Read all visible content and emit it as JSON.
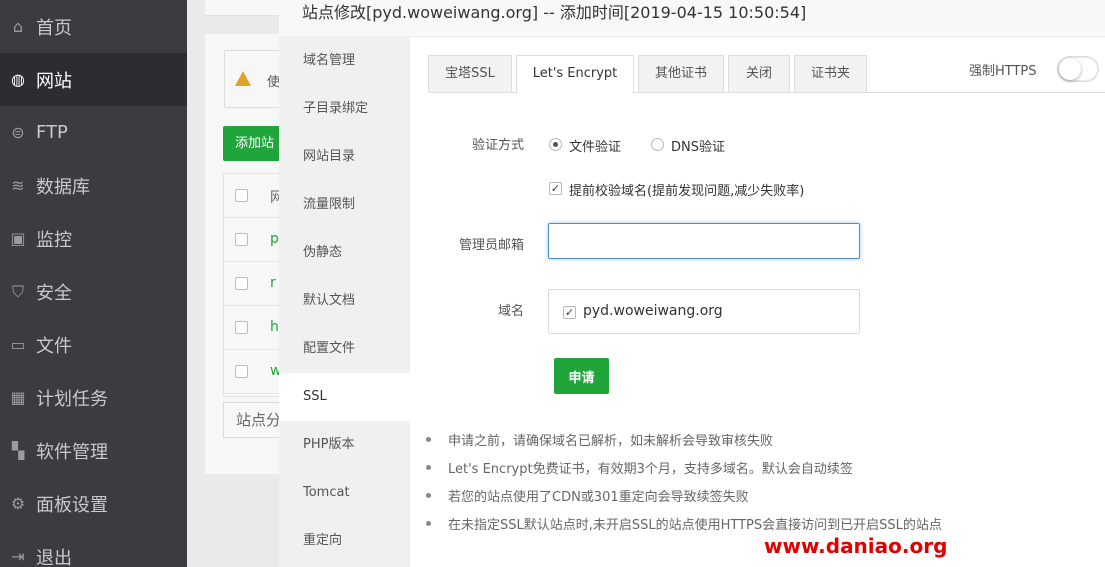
{
  "sidebar": {
    "items": [
      {
        "label": "首页",
        "icon": "home-icon"
      },
      {
        "label": "网站",
        "icon": "globe-icon"
      },
      {
        "label": "FTP",
        "icon": "ftp-icon"
      },
      {
        "label": "数据库",
        "icon": "database-icon"
      },
      {
        "label": "监控",
        "icon": "monitor-icon"
      },
      {
        "label": "安全",
        "icon": "shield-icon"
      },
      {
        "label": "文件",
        "icon": "folder-icon"
      },
      {
        "label": "计划任务",
        "icon": "calendar-icon"
      },
      {
        "label": "软件管理",
        "icon": "apps-icon"
      },
      {
        "label": "面板设置",
        "icon": "gear-icon"
      },
      {
        "label": "退出",
        "icon": "logout-icon"
      }
    ],
    "active_index": 1
  },
  "background": {
    "warning_text": "使",
    "add_button": "添加站",
    "table_rows": [
      "网",
      "p",
      "r",
      "h",
      "w"
    ],
    "select_text": "站点分"
  },
  "modal": {
    "title": "站点修改[pyd.woweiwang.org] -- 添加时间[2019-04-15 10:50:54]",
    "nav": [
      "域名管理",
      "子目录绑定",
      "网站目录",
      "流量限制",
      "伪静态",
      "默认文档",
      "配置文件",
      "SSL",
      "PHP版本",
      "Tomcat",
      "重定向"
    ],
    "nav_active_index": 7,
    "tabs": [
      "宝塔SSL",
      "Let's Encrypt",
      "其他证书",
      "关闭",
      "证书夹"
    ],
    "tab_active_index": 1,
    "force_https_label": "强制HTTPS",
    "force_https_on": false,
    "form": {
      "verify_label": "验证方式",
      "verify_options": [
        "文件验证",
        "DNS验证"
      ],
      "verify_selected": "文件验证",
      "precheck_label": "提前校验域名(提前发现问题,减少失败率)",
      "precheck_checked": true,
      "email_label": "管理员邮箱",
      "email_value": "",
      "domain_label": "域名",
      "domain_value": "pyd.woweiwang.org",
      "domain_checked": true,
      "apply_button": "申请"
    },
    "notes": [
      "申请之前，请确保域名已解析，如未解析会导致审核失败",
      "Let's Encrypt免费证书，有效期3个月，支持多域名。默认会自动续签",
      "若您的站点使用了CDN或301重定向会导致续签失败",
      "在未指定SSL默认站点时,未开启SSL的站点使用HTTPS会直接访问到已开启SSL的站点"
    ]
  },
  "watermark": "www.daniao.org",
  "colors": {
    "sidebar_bg": "#3b3c40",
    "accent_green": "#20a53a",
    "watermark_red": "#e00000",
    "focus_blue": "#4d90d8"
  }
}
